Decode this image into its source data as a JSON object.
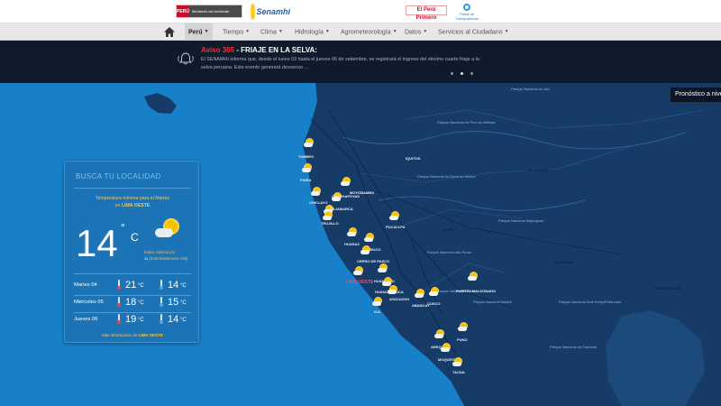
{
  "header": {
    "peru_logo": {
      "flag_text": "PERÚ",
      "ministry_text": "Ministerio del Ambiente"
    },
    "senamhi_logo": {
      "text": "Senamhi"
    },
    "elperu_logo": {
      "text": "El Perú Primero"
    },
    "transparency_logo": {
      "text": "Portal de Transparencia"
    }
  },
  "nav": {
    "home_icon": "home-icon",
    "items": [
      {
        "label": "Perú",
        "active": true
      },
      {
        "label": "Tiempo",
        "active": false
      },
      {
        "label": "Clima",
        "active": false
      },
      {
        "label": "Hidrología",
        "active": false
      },
      {
        "label": "Agrometeorología",
        "active": false
      },
      {
        "label": "Datos",
        "active": false
      },
      {
        "label": "Servicios al Ciudadano",
        "active": false
      }
    ]
  },
  "alert": {
    "icon": "bell-icon",
    "prefix": "Aviso 305",
    "title": " - FRIAJE EN LA SELVA:",
    "text": "El SENAMHI informa que, desde el lunes 03 hasta el jueves 06 de setiembre, se registrará el ingreso del décimo cuarto friaje a la selva peruana. Este evento generará descenso ..."
  },
  "forecast_button": {
    "label": "Pronóstico a nivel nacional"
  },
  "panel": {
    "title": "BUSCA TU LOCALIDAD",
    "subtitle_line1": "Temperatura mínima para el Martes",
    "subtitle_prefix": "en",
    "location": "LIMA OESTE",
    "current_temp": "14",
    "degree_symbol": "°",
    "unit": "C",
    "uv_label": "Índice máximo UV:",
    "uv_value": "11",
    "uv_desc": "(Extremadamente Alta)",
    "days": [
      {
        "day": "Martes 04",
        "max": "21",
        "min": "14"
      },
      {
        "day": "Miércoles 05",
        "max": "18",
        "min": "15"
      },
      {
        "day": "Jueves 06",
        "max": "19",
        "min": "14"
      }
    ],
    "temp_unit": "°C",
    "footer_prefix": "Más información de",
    "footer_location": "LIMA OESTE"
  },
  "map": {
    "cities": [
      "TUMBES",
      "PIURA",
      "CHICLAYO",
      "MOYOBAMBA",
      "CHACHAPOYAS",
      "CAJAMARCA",
      "TRUJILLO",
      "HUARAZ",
      "PUCALLPA",
      "HUANUCO",
      "CERRO DE PASCO",
      "HUANCAYO",
      "LIMA OESTE",
      "HUANCAVELICA",
      "AYACUCHO",
      "ICA",
      "ABANCAY",
      "CUSCO",
      "PUERTO MALDONADO",
      "PUNO",
      "AREQUIPA",
      "MOQUEGUA",
      "TACNA",
      "IQUITOS"
    ],
    "regions": [
      "AMAZONAS",
      "RONDONIA",
      "MATO GROSSO",
      "ACRE"
    ],
    "parks": [
      "Parque Nacional do Jaú",
      "Parque Nacional da Serra do Divisor",
      "Parque Nacional do Pico da Neblina",
      "Parque Nacional Mapinguari",
      "Parque Nacional Alto Purus",
      "Parque Nacional Manu",
      "Parque Nacional Madidi",
      "Parque Nacional Noel Kempff Mercado",
      "Parque Nacional do Pantanal"
    ]
  }
}
